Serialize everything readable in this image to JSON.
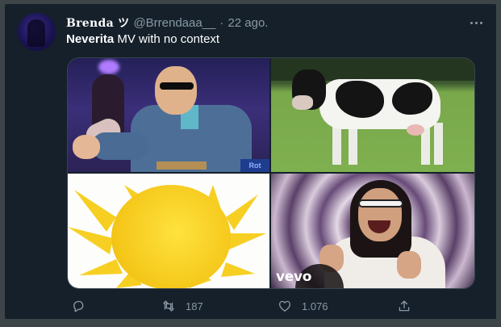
{
  "tweet": {
    "display_name": "Brenda ツ",
    "handle": "@Brrendaaa__",
    "separator": "·",
    "date": "22 ago.",
    "text_bold": "Neverita",
    "text_rest": " MV with no context"
  },
  "media": {
    "watermark_sign": "Rot",
    "watermark_vevo": "vevo"
  },
  "actions": {
    "reply_count": "",
    "retweet_count": "187",
    "like_count": "1.076"
  },
  "colors": {
    "background": "#15202b",
    "page": "#3d4549",
    "secondary_text": "#8899a6",
    "primary_text": "#ffffff"
  },
  "icons": [
    "more-horizontal-icon",
    "reply-icon",
    "retweet-icon",
    "like-icon",
    "share-icon"
  ]
}
